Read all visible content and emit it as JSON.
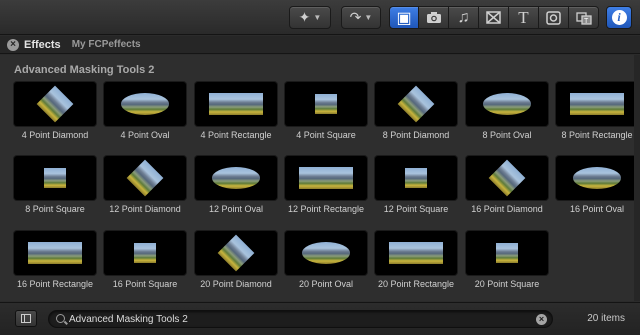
{
  "toolbar": {
    "buttons": [
      {
        "icon": "magic-wand-icon",
        "glyph": "✦"
      },
      {
        "icon": "rotate-icon",
        "glyph": "↷"
      }
    ],
    "browser_types": [
      {
        "icon": "effects-browser-icon",
        "glyph": "▣",
        "active": true
      },
      {
        "icon": "camera-icon",
        "glyph": "📷"
      },
      {
        "icon": "music-note-icon",
        "glyph": "♫"
      },
      {
        "icon": "transitions-icon",
        "glyph": "⊠"
      },
      {
        "icon": "titles-icon",
        "glyph": "T"
      },
      {
        "icon": "generators-icon",
        "glyph": "◙"
      },
      {
        "icon": "themes-icon",
        "glyph": "▦"
      }
    ],
    "info_glyph": "i",
    "accent_color": "#2f6fd8"
  },
  "tabs": {
    "active": "Effects",
    "other": "My FCPeffects"
  },
  "section": {
    "title": "Advanced Masking Tools 2"
  },
  "effects": [
    {
      "label": "4 Point Diamond",
      "shape": "diamond"
    },
    {
      "label": "4 Point Oval",
      "shape": "oval"
    },
    {
      "label": "4 Point Rectangle",
      "shape": "rect"
    },
    {
      "label": "4 Point Square",
      "shape": "square"
    },
    {
      "label": "8 Point Diamond",
      "shape": "diamond"
    },
    {
      "label": "8 Point Oval",
      "shape": "oval"
    },
    {
      "label": "8 Point Rectangle",
      "shape": "rect"
    },
    {
      "label": "8 Point Square",
      "shape": "square"
    },
    {
      "label": "12 Point Diamond",
      "shape": "diamond"
    },
    {
      "label": "12 Point Oval",
      "shape": "oval"
    },
    {
      "label": "12 Point Rectangle",
      "shape": "rect"
    },
    {
      "label": "12 Point Square",
      "shape": "square"
    },
    {
      "label": "16 Point Diamond",
      "shape": "diamond"
    },
    {
      "label": "16 Point Oval",
      "shape": "oval"
    },
    {
      "label": "16 Point Rectangle",
      "shape": "rect"
    },
    {
      "label": "16 Point Square",
      "shape": "square"
    },
    {
      "label": "20 Point Diamond",
      "shape": "diamond"
    },
    {
      "label": "20 Point Oval",
      "shape": "oval"
    },
    {
      "label": "20 Point Rectangle",
      "shape": "rect"
    },
    {
      "label": "20 Point Square",
      "shape": "square"
    }
  ],
  "search": {
    "value": "Advanced Masking Tools 2"
  },
  "footer": {
    "item_count": "20 items"
  }
}
